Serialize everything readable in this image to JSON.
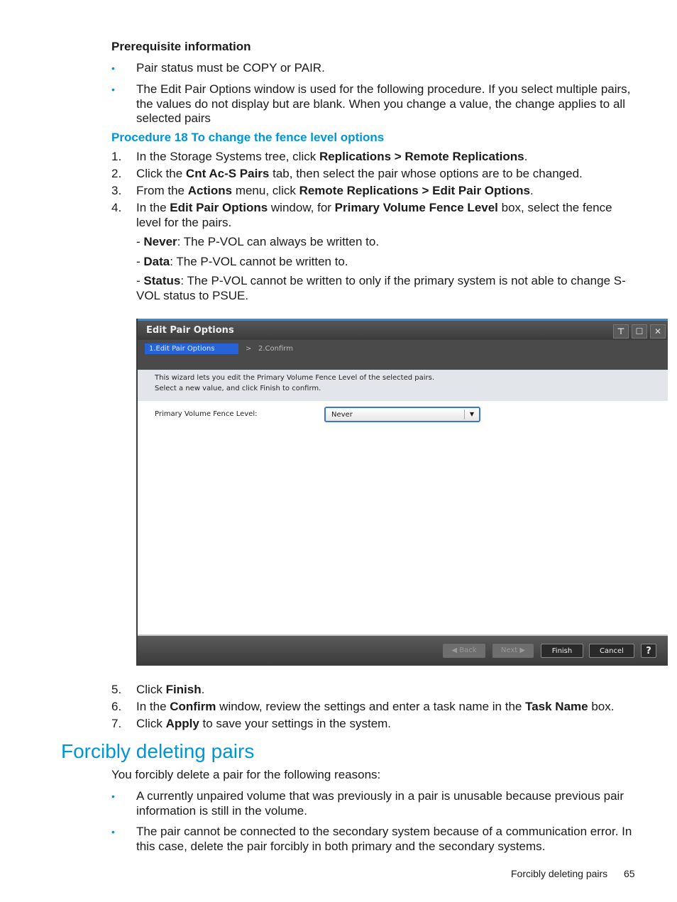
{
  "prereq": {
    "heading": "Prerequisite information",
    "bullets": [
      [
        {
          "t": "Pair status must be COPY or PAIR."
        }
      ],
      [
        {
          "t": "The Edit Pair Options window is used for the following procedure. If you select multiple pairs, the values do not display but are blank. When you change a value, the change applies to all selected pairs"
        }
      ]
    ]
  },
  "procedure": {
    "title": "Procedure 18 To change the fence level options",
    "steps": [
      {
        "n": "1.",
        "segs": [
          {
            "t": "In the Storage Systems tree, click "
          },
          {
            "t": "Replications > Remote Replications",
            "b": true
          },
          {
            "t": "."
          }
        ]
      },
      {
        "n": "2.",
        "segs": [
          {
            "t": "Click the "
          },
          {
            "t": "Cnt Ac-S Pairs",
            "b": true
          },
          {
            "t": " tab, then select the pair whose options are to be changed."
          }
        ]
      },
      {
        "n": "3.",
        "segs": [
          {
            "t": "From the "
          },
          {
            "t": "Actions",
            "b": true
          },
          {
            "t": " menu, click "
          },
          {
            "t": "Remote Replications > Edit Pair Options",
            "b": true
          },
          {
            "t": "."
          }
        ]
      },
      {
        "n": "4.",
        "segs": [
          {
            "t": "In the "
          },
          {
            "t": "Edit Pair Options",
            "b": true
          },
          {
            "t": " window, for "
          },
          {
            "t": "Primary Volume Fence Level",
            "b": true
          },
          {
            "t": " box, select the fence level for the pairs."
          }
        ]
      }
    ],
    "options": [
      [
        {
          "t": "- "
        },
        {
          "t": "Never",
          "b": true
        },
        {
          "t": ": The P-VOL can always be written to."
        }
      ],
      [
        {
          "t": "- "
        },
        {
          "t": "Data",
          "b": true
        },
        {
          "t": ": The P-VOL cannot be written to."
        }
      ],
      [
        {
          "t": "- "
        },
        {
          "t": "Status",
          "b": true
        },
        {
          "t": ": The P-VOL cannot be written to only if the primary system is not able to change S-VOL status to PSUE."
        }
      ]
    ],
    "later_steps": [
      {
        "n": "5.",
        "segs": [
          {
            "t": "Click "
          },
          {
            "t": "Finish",
            "b": true
          },
          {
            "t": "."
          }
        ]
      },
      {
        "n": "6.",
        "segs": [
          {
            "t": "In the "
          },
          {
            "t": "Confirm",
            "b": true
          },
          {
            "t": " window, review the settings and enter a task name in the "
          },
          {
            "t": "Task Name",
            "b": true
          },
          {
            "t": " box."
          }
        ]
      },
      {
        "n": "7.",
        "segs": [
          {
            "t": "Click "
          },
          {
            "t": "Apply",
            "b": true
          },
          {
            "t": " to save your settings in the system."
          }
        ]
      }
    ]
  },
  "dialog": {
    "title": "Edit Pair Options",
    "window_icons": [
      "pin-icon",
      "maximize-icon",
      "close-icon"
    ],
    "window_glyphs": [
      "⊤",
      "☐",
      "✕"
    ],
    "steps": {
      "active": "1.Edit Pair Options",
      "separator": ">",
      "next": "2.Confirm"
    },
    "description": [
      "This wizard lets you edit the Primary Volume Fence Level of the selected pairs.",
      "Select a new value, and click Finish to confirm."
    ],
    "field_label": "Primary Volume Fence Level:",
    "field_value": "Never",
    "dropdown_arrow": "▼",
    "buttons": {
      "back": "◀ Back",
      "next": "Next ▶",
      "finish": "Finish",
      "cancel": "Cancel",
      "help": "?"
    },
    "colors": {
      "accent": "#2563d6",
      "titlebar": "#444444"
    }
  },
  "section": {
    "heading": "Forcibly deleting pairs",
    "intro": "You forcibly delete a pair for the following reasons:",
    "bullets": [
      [
        {
          "t": "A currently unpaired volume that was previously in a pair is unusable because previous pair information is still in the volume."
        }
      ],
      [
        {
          "t": "The pair cannot be connected to the secondary system because of a communication error. In this case, delete the pair forcibly in both primary and the secondary systems."
        }
      ]
    ]
  },
  "footer": {
    "section": "Forcibly deleting pairs",
    "page": "65"
  },
  "bullet_glyph": "•"
}
